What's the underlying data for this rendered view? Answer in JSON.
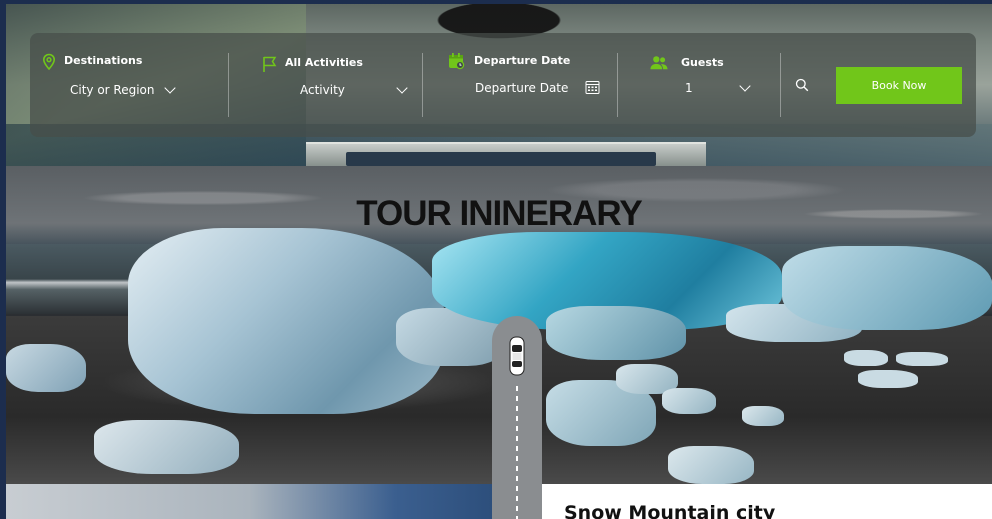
{
  "search": {
    "destinations": {
      "label": "Destinations",
      "value": "City or Region",
      "icon": "map-pin-icon"
    },
    "activities": {
      "label": "All Activities",
      "value": "Activity",
      "icon": "flag-icon"
    },
    "departure": {
      "label": "Departure Date",
      "value": "Departure Date",
      "icon": "calendar-icon"
    },
    "guests": {
      "label": "Guests",
      "value": "1",
      "icon": "users-icon"
    },
    "search_icon": "search-icon",
    "book_label": "Book Now"
  },
  "itinerary": {
    "title": "TOUR ININERARY"
  },
  "card": {
    "title": "Snow Mountain city"
  },
  "colors": {
    "accent": "#71c61a",
    "page_border": "#1c2d4e"
  }
}
